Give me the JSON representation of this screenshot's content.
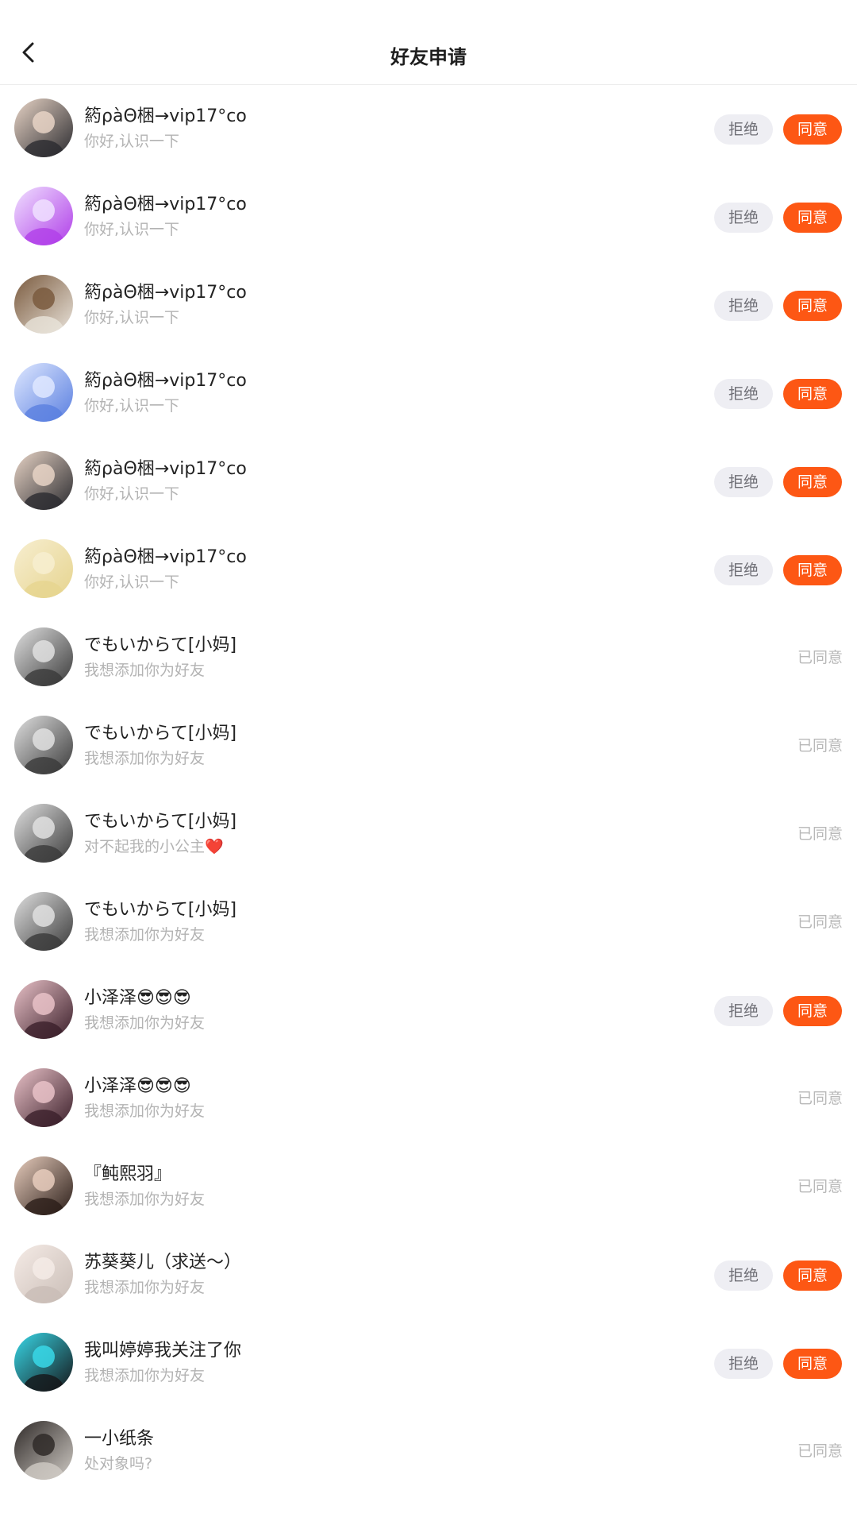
{
  "header": {
    "title": "好友申请",
    "back_icon": "chevron-left-icon"
  },
  "labels": {
    "reject": "拒绝",
    "accept": "同意",
    "accepted": "已同意"
  },
  "colors": {
    "accent": "#fd5714",
    "reject_bg": "#eeeef3"
  },
  "requests": [
    {
      "name": "箹ρàΘ梱→vip17°co",
      "message": "你好,认识一下",
      "status": "pending",
      "avatar": [
        "#2b2b2f",
        "#e8d4c6"
      ]
    },
    {
      "name": "箹ρàΘ梱→vip17°co",
      "message": "你好,认识一下",
      "status": "pending",
      "avatar": [
        "#b03ee8",
        "#f0e0ff"
      ]
    },
    {
      "name": "箹ρàΘ梱→vip17°co",
      "message": "你好,认识一下",
      "status": "pending",
      "avatar": [
        "#e9e3da",
        "#7a5a3e"
      ]
    },
    {
      "name": "箹ρàΘ梱→vip17°co",
      "message": "你好,认识一下",
      "status": "pending",
      "avatar": [
        "#5a7fe0",
        "#dfe8ff"
      ]
    },
    {
      "name": "箹ρàΘ梱→vip17°co",
      "message": "你好,认识一下",
      "status": "pending",
      "avatar": [
        "#2b2b2f",
        "#e8d4c6"
      ]
    },
    {
      "name": "箹ρàΘ梱→vip17°co",
      "message": "你好,认识一下",
      "status": "pending",
      "avatar": [
        "#e6d48f",
        "#f7eed0"
      ]
    },
    {
      "name": "でもいからて[小妈]",
      "message": "我想添加你为好友",
      "status": "accepted",
      "avatar": [
        "#3a3a3a",
        "#e0e0e0"
      ]
    },
    {
      "name": "でもいからて[小妈]",
      "message": "我想添加你为好友",
      "status": "accepted",
      "avatar": [
        "#3a3a3a",
        "#e0e0e0"
      ]
    },
    {
      "name": "でもいからて[小妈]",
      "message": "对不起我的小公主❤️",
      "status": "accepted",
      "avatar": [
        "#3a3a3a",
        "#e0e0e0"
      ]
    },
    {
      "name": "でもいからて[小妈]",
      "message": "我想添加你为好友",
      "status": "accepted",
      "avatar": [
        "#3a3a3a",
        "#e0e0e0"
      ]
    },
    {
      "name": "小泽泽😎😎😎",
      "message": "我想添加你为好友",
      "status": "pending",
      "avatar": [
        "#3b1f2a",
        "#e9c2c8"
      ]
    },
    {
      "name": "小泽泽😎😎😎",
      "message": "我想添加你为好友",
      "status": "accepted",
      "avatar": [
        "#3b1f2a",
        "#e9c2c8"
      ]
    },
    {
      "name": "『鲀熙羽』",
      "message": "我想添加你为好友",
      "status": "accepted",
      "avatar": [
        "#2a1d18",
        "#e8cdbd"
      ]
    },
    {
      "name": "苏葵葵儿（求送～）",
      "message": "我想添加你为好友",
      "status": "pending",
      "avatar": [
        "#c9bdb6",
        "#f5ebe6"
      ]
    },
    {
      "name": "我叫婷婷我关注了你",
      "message": "我想添加你为好友",
      "status": "pending",
      "avatar": [
        "#151518",
        "#38d8e8"
      ]
    },
    {
      "name": "一小纸条",
      "message": "处对象吗?",
      "status": "accepted",
      "avatar": [
        "#cfcac4",
        "#2f2a28"
      ]
    }
  ]
}
